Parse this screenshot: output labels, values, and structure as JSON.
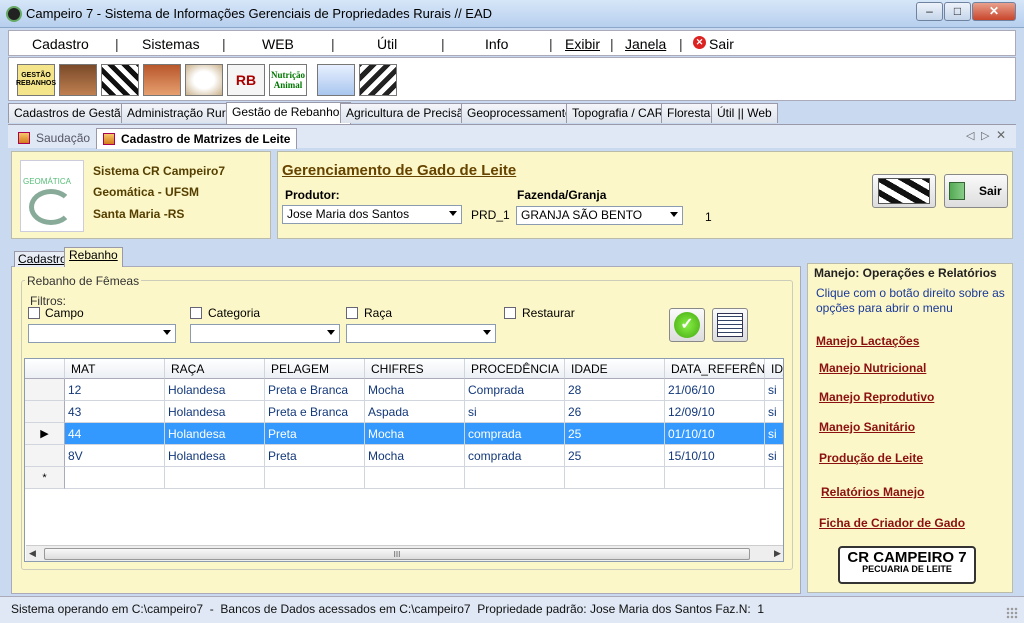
{
  "window": {
    "title": "Campeiro 7 - Sistema de Informações Gerenciais de Propriedades Rurais // EAD"
  },
  "menu": {
    "items": [
      "Cadastro",
      "Sistemas",
      "WEB",
      "Útil",
      "Info",
      "Exibir",
      "Janela",
      "Sair"
    ]
  },
  "toolbar": {
    "gestao_label_1": "GESTÃO",
    "gestao_label_2": "REBANHOS",
    "nutricao_1": "Nutrição",
    "nutricao_2": "Animal",
    "rb": "RB"
  },
  "tabs": [
    "Cadastros de Gestão",
    "Administração Rural",
    "Gestão de Rebanhos",
    "Agricultura de Precisão",
    "Geoprocessamento",
    "Topografia / CAR",
    "Florestal",
    "Útil || Web"
  ],
  "doc_tabs": [
    "Saudação",
    "Cadastro de Matrizes de Leite"
  ],
  "org": {
    "line1": "Sistema CR Campeiro7",
    "line2": "Geomática - UFSM",
    "line3": "Santa Maria -RS",
    "logo_text": "GEOMÁTICA"
  },
  "header": {
    "title": "Gerenciamento de Gado de Leite",
    "produtor_label": "Produtor:",
    "produtor_value": "Jose Maria dos Santos",
    "prd_code": "PRD_1",
    "fazenda_label": "Fazenda/Granja",
    "fazenda_value": "GRANJA SÃO BENTO",
    "fazenda_num": "1",
    "sair_label": "Sair"
  },
  "subtabs": [
    "Cadastro",
    "Rebanho"
  ],
  "rebanho": {
    "group_label": "Rebanho de Fêmeas",
    "filtros_label": "Filtros:",
    "filters": [
      "Campo",
      "Categoria",
      "Raça",
      "Restaurar"
    ]
  },
  "grid": {
    "columns": [
      "MAT",
      "RAÇA",
      "PELAGEM",
      "CHIFRES",
      "PROCEDÊNCIA",
      "IDADE",
      "DATA_REFERÊNCIA",
      "ID_"
    ],
    "rows": [
      [
        "12",
        "Holandesa",
        "Preta e Branca",
        "Mocha",
        "Comprada",
        "28",
        "21/06/10",
        "si"
      ],
      [
        "43",
        "Holandesa",
        "Preta e Branca",
        "Aspada",
        "si",
        "26",
        "12/09/10",
        "si"
      ],
      [
        "44",
        "Holandesa",
        "Preta",
        "Mocha",
        "comprada",
        "25",
        "01/10/10",
        "si"
      ],
      [
        "8V",
        "Holandesa",
        "Preta",
        "Mocha",
        "comprada",
        "25",
        "15/10/10",
        "si"
      ]
    ],
    "selected_row": 2,
    "new_row_marker": "*",
    "current_row_marker": "▶",
    "scroll_grip": "III"
  },
  "sidebar": {
    "title": "Manejo: Operações e Relatórios",
    "hint": "Clique com o botão direito sobre as opções para abrir o menu",
    "links": [
      "Manejo Lactações",
      "Manejo Nutricional",
      "Manejo Reprodutivo",
      "Manejo Sanitário",
      "Produção de Leite",
      "Relatórios Manejo",
      "Ficha de Criador de Gado"
    ],
    "brand_1": "CR CAMPEIRO 7",
    "brand_2": "PECUARIA DE LEITE"
  },
  "status": {
    "text": "Sistema operando em C:\\campeiro7  -  Bancos de Dados acessados em C:\\campeiro7  Propriedade padrão: Jose Maria dos Santos Faz.N:  1"
  }
}
